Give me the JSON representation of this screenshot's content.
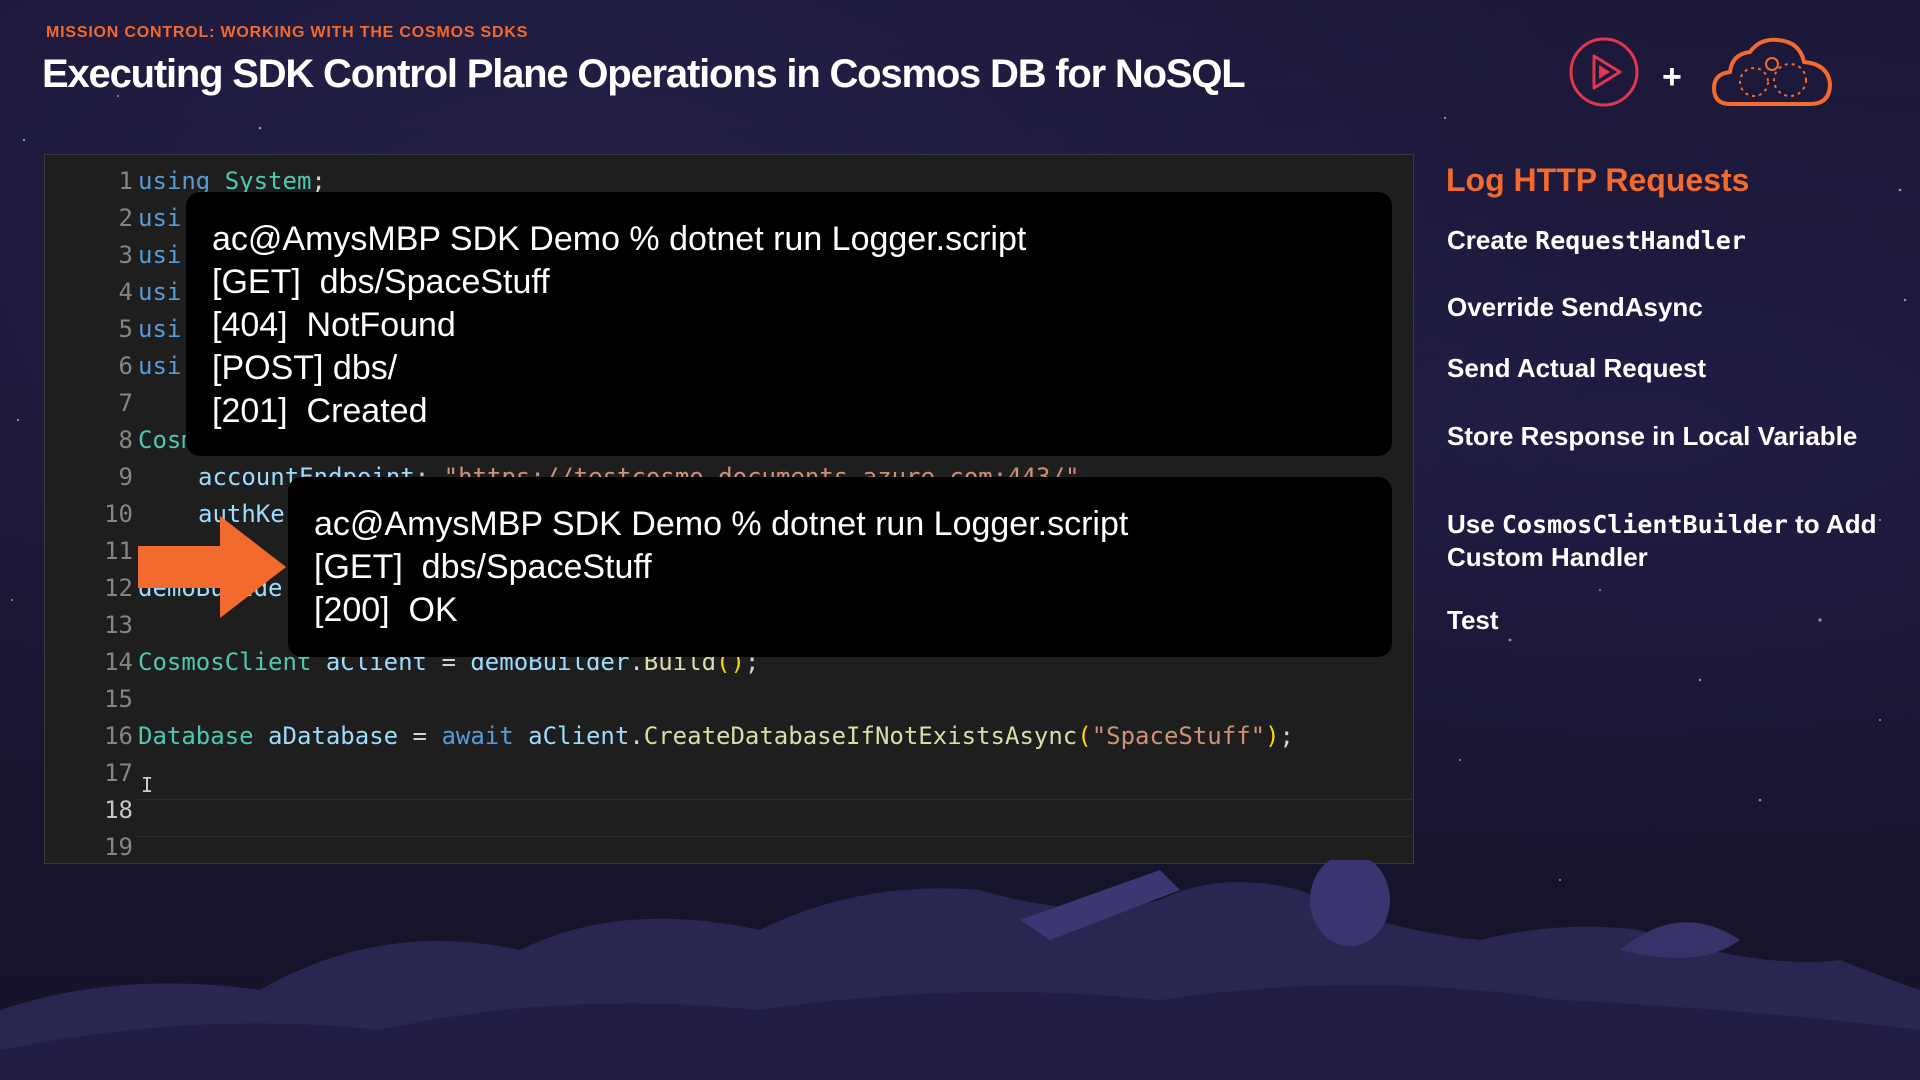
{
  "header": {
    "eyebrow": "MISSION CONTROL: WORKING WITH THE COSMOS SDKS",
    "title": "Executing SDK Control Plane Operations in Cosmos DB for NoSQL",
    "plus": "+"
  },
  "editor": {
    "line_numbers": [
      "1",
      "2",
      "3",
      "4",
      "5",
      "6",
      "7",
      "8",
      "9",
      "10",
      "11",
      "12",
      "13",
      "14",
      "15",
      "16",
      "17",
      "18",
      "19"
    ],
    "active_line": "18",
    "line1": {
      "kw": "using",
      "ns": "System",
      "end": ";"
    },
    "line2": "usi",
    "line3": "usi",
    "line4": "usi",
    "line5": "usi",
    "line6": "usi",
    "line8": "Cosm",
    "line9": {
      "id": "accountEndpoint:",
      "str": "\"https://testcosmo.documents.azure.com:443/\""
    },
    "line10": "authKe",
    "line12": "demoBuilde",
    "line14": {
      "type": "CosmosClient",
      "var": "aClient",
      "eq": " = ",
      "obj": "demoBuilder",
      "dot": ".",
      "method": "Build",
      "paren": "()",
      "end": ";"
    },
    "line16": {
      "type": "Database",
      "var": "aDatabase",
      "eq": " = ",
      "await": "await",
      "obj": "aClient",
      "dot": ".",
      "method": "CreateDatabaseIfNotExistsAsync",
      "open": "(",
      "arg": "\"SpaceStuff\"",
      "close": ")",
      "end": ";"
    }
  },
  "terminal1": {
    "lines": [
      "ac@AmysMBP SDK Demo % dotnet run Logger.script",
      "[GET]  dbs/SpaceStuff",
      "[404]  NotFound",
      "[POST] dbs/",
      "[201]  Created"
    ]
  },
  "terminal2": {
    "lines": [
      "ac@AmysMBP SDK Demo % dotnet run Logger.script",
      "[GET]  dbs/SpaceStuff",
      "[200]  OK"
    ]
  },
  "sidebar": {
    "title": "Log HTTP Requests",
    "items": [
      {
        "prefix": "Create ",
        "mono": "RequestHandler",
        "suffix": ""
      },
      {
        "text": "Override SendAsync"
      },
      {
        "text": "Send Actual Request"
      },
      {
        "text": "Store Response in Local Variable"
      },
      {
        "prefix": "Use ",
        "mono": "CosmosClientBuilder",
        "suffix": " to Add Custom Handler"
      },
      {
        "text": "Test"
      }
    ]
  },
  "icons": {
    "play": "play-logo-icon",
    "cloud": "cloud-logo-icon",
    "arrow": "arrow-right-icon",
    "caret": "text-cursor-icon"
  },
  "colors": {
    "accent": "#f26a2e",
    "editor_bg": "#1e1e1e",
    "terminal_bg": "#000000",
    "play_logo": "#e2354f"
  }
}
